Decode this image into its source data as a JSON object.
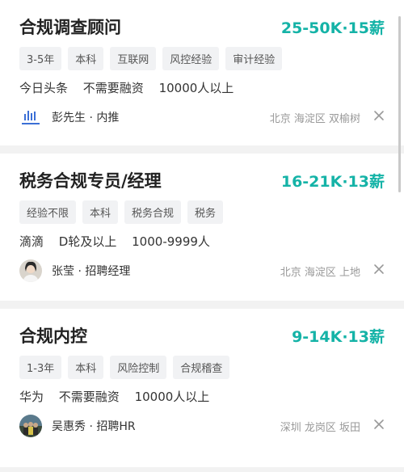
{
  "jobs": [
    {
      "title": "合规调查顾问",
      "salary": "25-50K·15薪",
      "tags": [
        "3-5年",
        "本科",
        "互联网",
        "风控经验",
        "审计经验"
      ],
      "company": {
        "name": "今日头条",
        "funding": "不需要融资",
        "size": "10000人以上"
      },
      "recruiter": "彭先生 · 内推",
      "avatar_icon": "company-logo-icon",
      "location": "北京 海淀区 双榆树"
    },
    {
      "title": "税务合规专员/经理",
      "salary": "16-21K·13薪",
      "tags": [
        "经验不限",
        "本科",
        "税务合规",
        "税务"
      ],
      "company": {
        "name": "滴滴",
        "funding": "D轮及以上",
        "size": "1000-9999人"
      },
      "recruiter": "张莹 · 招聘经理",
      "avatar_icon": "person-avatar-icon",
      "location": "北京 海淀区 上地"
    },
    {
      "title": "合规内控",
      "salary": "9-14K·13薪",
      "tags": [
        "1-3年",
        "本科",
        "风险控制",
        "合规稽查"
      ],
      "company": {
        "name": "华为",
        "funding": "不需要融资",
        "size": "10000人以上"
      },
      "recruiter": "吴惠秀 · 招聘HR",
      "avatar_icon": "group-photo-avatar-icon",
      "location": "深圳 龙岗区 坂田"
    }
  ],
  "colors": {
    "salary": "#15b3a7",
    "tag_bg": "#f1f2f4",
    "page_bg": "#f2f2f2"
  }
}
